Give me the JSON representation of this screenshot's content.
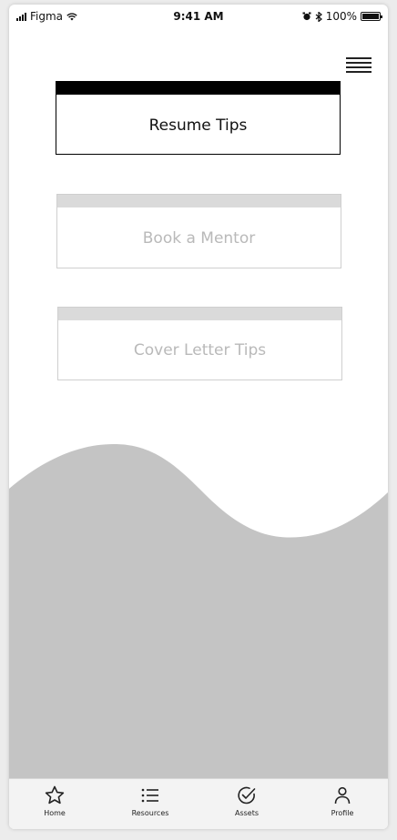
{
  "status_bar": {
    "carrier": "Figma",
    "time": "9:41 AM",
    "battery": "100%",
    "battery_level": 1.0
  },
  "header": {
    "menu_icon": "hamburger-menu-icon"
  },
  "cards": [
    {
      "label": "Resume Tips",
      "state": "selected"
    },
    {
      "label": "Book a Mentor",
      "state": "default"
    },
    {
      "label": "Cover Letter Tips",
      "state": "default"
    }
  ],
  "tabbar": {
    "items": [
      {
        "label": "Home",
        "icon": "star-icon"
      },
      {
        "label": "Resources",
        "icon": "list-icon"
      },
      {
        "label": "Assets",
        "icon": "check-circle-icon"
      },
      {
        "label": "Profile",
        "icon": "person-icon"
      }
    ]
  },
  "colors": {
    "wave": "#c4c4c4",
    "card_active": "#000000",
    "card_inactive_bar": "#dadada",
    "card_inactive_text": "#b9b9b9"
  }
}
